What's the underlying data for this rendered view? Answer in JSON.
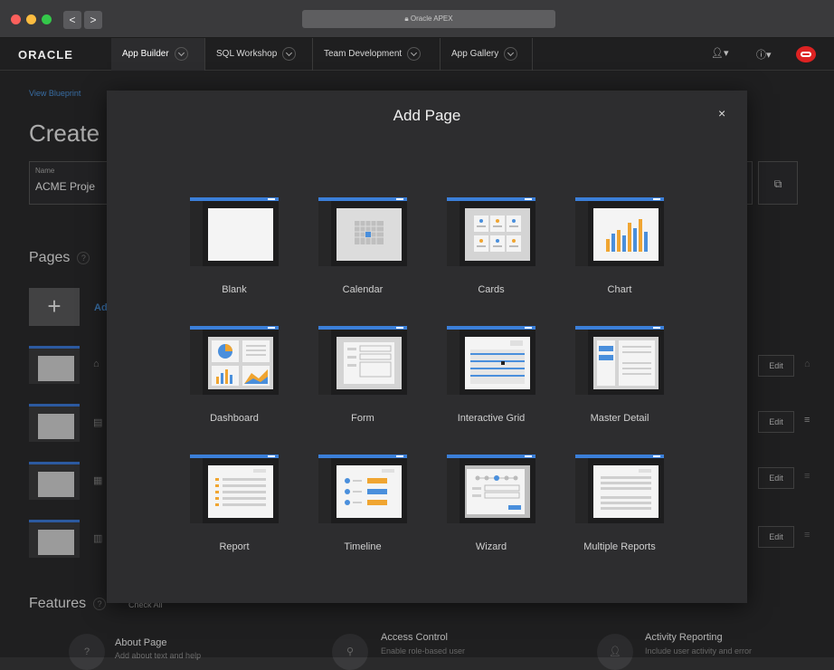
{
  "browser": {
    "url_text": "Oracle APEX",
    "back": "<",
    "forward": ">"
  },
  "apex_nav": {
    "logo": "ORACLE",
    "tabs": [
      "App Builder",
      "SQL Workshop",
      "Team Development",
      "App Gallery"
    ],
    "user_icon": "user-icon",
    "help_icon": "help-icon"
  },
  "background": {
    "breadcrumb": "View Blueprint",
    "title": "Create",
    "name_label": "Name",
    "name_value": "ACME Proje",
    "pages_heading": "Pages",
    "help_symbol": "?",
    "add_symbol": "+",
    "add_text": "Ad",
    "edit_label": "Edit",
    "features_heading": "Features",
    "check_all": "Check All",
    "features": [
      {
        "title": "About Page",
        "desc": "Add about text and help"
      },
      {
        "title": "Access Control",
        "desc": "Enable role-based user"
      },
      {
        "title": "Activity Reporting",
        "desc": "Include user activity and error"
      }
    ]
  },
  "modal": {
    "title": "Add Page",
    "close": "×",
    "tiles": [
      "Blank",
      "Calendar",
      "Cards",
      "Chart",
      "Dashboard",
      "Form",
      "Interactive Grid",
      "Master Detail",
      "Report",
      "Timeline",
      "Wizard",
      "Multiple Reports"
    ]
  },
  "colors": {
    "accent": "#3b7fd9",
    "chart_orange": "#f0a531",
    "chart_blue": "#4a8fdc"
  }
}
